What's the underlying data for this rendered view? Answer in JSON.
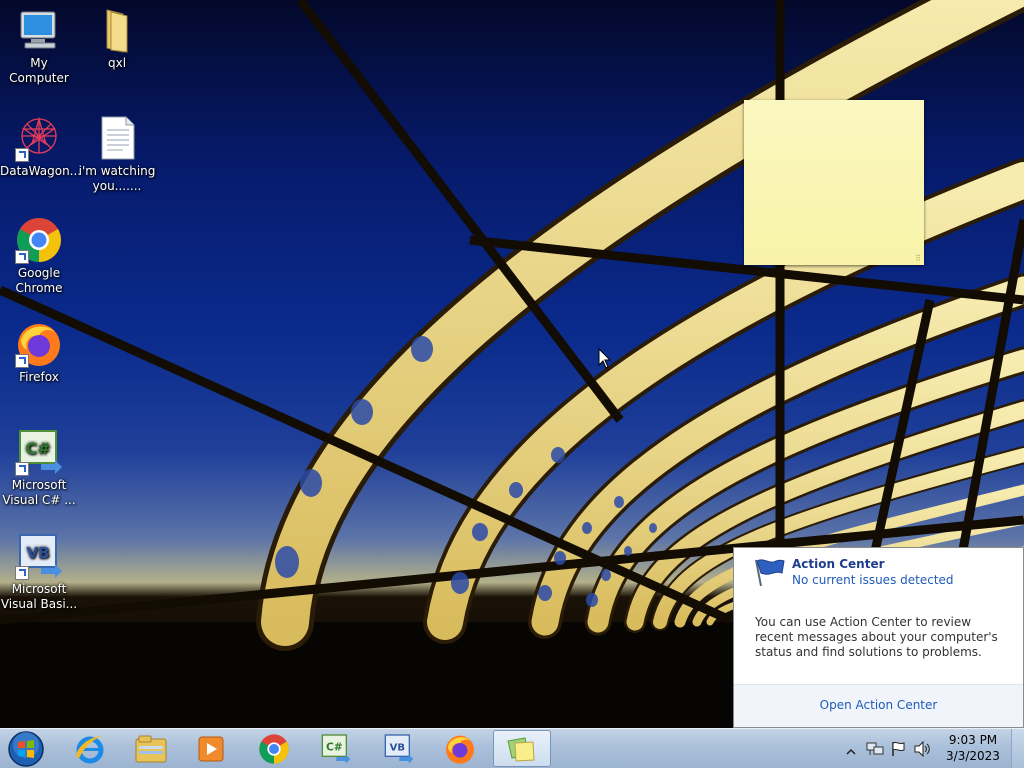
{
  "desktop": {
    "icons": [
      {
        "label": "My Computer",
        "icon": "computer-icon"
      },
      {
        "label": "qxl",
        "icon": "folder-icon"
      },
      {
        "label": "DataWagon...",
        "icon": "datawagon-icon"
      },
      {
        "label": "i'm watching you.......",
        "icon": "text-file-icon"
      },
      {
        "label": "Google Chrome",
        "icon": "chrome-icon"
      },
      {
        "label": "Firefox",
        "icon": "firefox-icon"
      },
      {
        "label": "Microsoft Visual C# ...",
        "icon": "visual-csharp-icon"
      },
      {
        "label": "Microsoft Visual Basi...",
        "icon": "visual-basic-icon"
      }
    ]
  },
  "sticky_note": {
    "text": ""
  },
  "action_center": {
    "title": "Action Center",
    "status": "No current issues detected",
    "description": "You can use Action Center to review recent messages about your computer's status and find solutions to problems.",
    "link": "Open Action Center"
  },
  "taskbar": {
    "start": "start-orb-icon",
    "pinned": [
      {
        "name": "internet-explorer-icon"
      },
      {
        "name": "windows-explorer-icon"
      },
      {
        "name": "media-player-icon"
      },
      {
        "name": "chrome-icon"
      },
      {
        "name": "visual-csharp-icon"
      },
      {
        "name": "visual-basic-icon"
      },
      {
        "name": "firefox-icon"
      },
      {
        "name": "sticky-notes-icon",
        "active": true
      }
    ],
    "tray": [
      "show-hidden-icons-icon",
      "network-icon",
      "action-center-flag-icon",
      "volume-icon"
    ],
    "clock": {
      "time": "9:03 PM",
      "date": "3/3/2023"
    }
  },
  "colors": {
    "taskbar": "#aac0da",
    "sticky": "#f8f3a8",
    "link": "#1e5bb8"
  }
}
